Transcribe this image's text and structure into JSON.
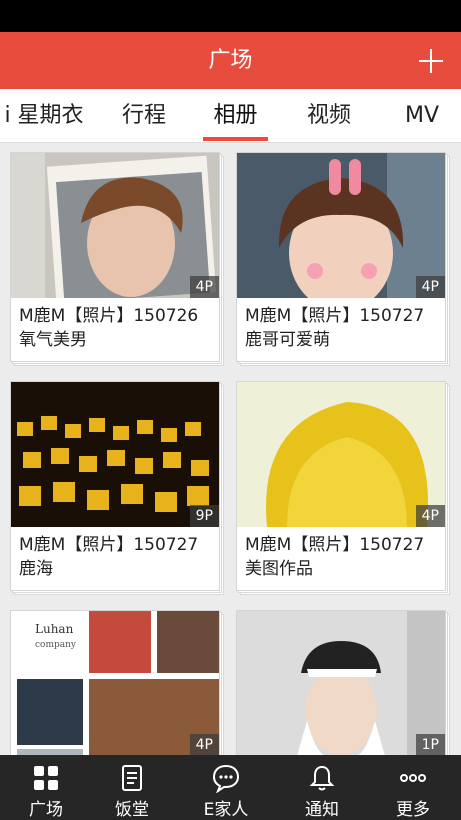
{
  "app_bar": {
    "title": "广场"
  },
  "tabs": [
    {
      "label": "i 星期衣",
      "active": false
    },
    {
      "label": "行程",
      "active": false
    },
    {
      "label": "相册",
      "active": true
    },
    {
      "label": "视频",
      "active": false
    },
    {
      "label": "MV",
      "active": false
    }
  ],
  "albums": [
    {
      "count": "4P",
      "caption": "M鹿M【照片】150726氧气美男",
      "image": "photo-icon"
    },
    {
      "count": "4P",
      "caption": "M鹿M【照片】150727鹿哥可爱萌",
      "image": "photo-icon"
    },
    {
      "count": "9P",
      "caption": "M鹿M【照片】150727鹿海",
      "image": "photo-icon"
    },
    {
      "count": "4P",
      "caption": "M鹿M【照片】150727美图作品",
      "image": "photo-icon"
    },
    {
      "count": "4P",
      "caption": "",
      "image": "photo-icon"
    },
    {
      "count": "1P",
      "caption": "",
      "image": "photo-icon"
    }
  ],
  "collage": {
    "logo_line1": "Luhan",
    "logo_line2": "company"
  },
  "bottom_nav": [
    {
      "label": "广场",
      "icon": "grid-icon"
    },
    {
      "label": "饭堂",
      "icon": "document-icon"
    },
    {
      "label": "E家人",
      "icon": "chat-icon"
    },
    {
      "label": "通知",
      "icon": "bell-icon"
    },
    {
      "label": "更多",
      "icon": "more-icon"
    }
  ],
  "colors": {
    "accent": "#e74c3c",
    "nav_bg": "#262626"
  }
}
